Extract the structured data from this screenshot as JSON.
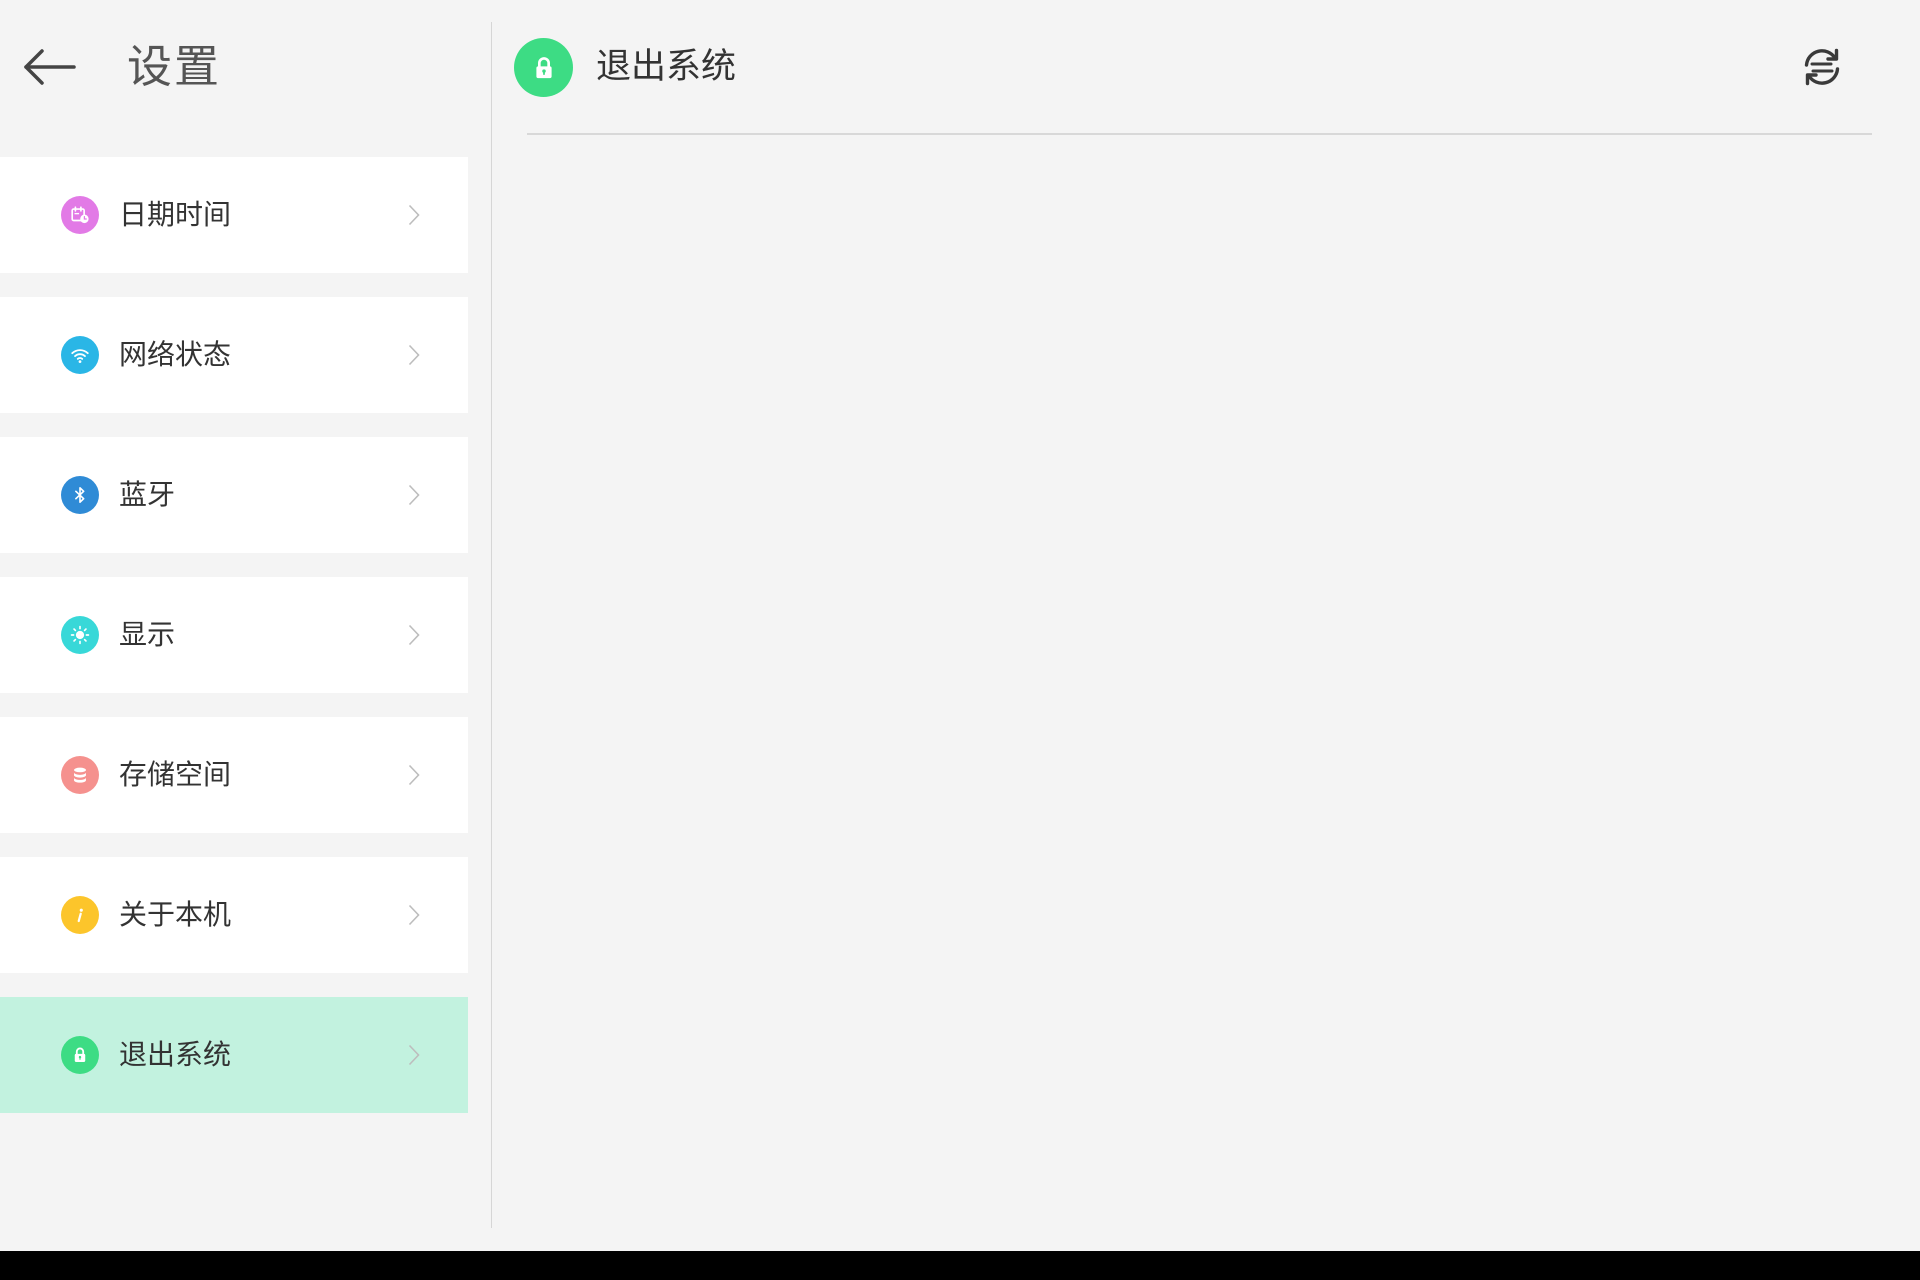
{
  "sidebar": {
    "title": "设置",
    "back_icon": "arrow-left-icon",
    "items": [
      {
        "label": "日期时间",
        "icon": "calendar-clock-icon",
        "color": "#e27ae6",
        "active": false
      },
      {
        "label": "网络状态",
        "icon": "wifi-icon",
        "color": "#2ab6e6",
        "active": false
      },
      {
        "label": "蓝牙",
        "icon": "bluetooth-icon",
        "color": "#2f8bd6",
        "active": false
      },
      {
        "label": "显示",
        "icon": "sun-icon",
        "color": "#38d8d8",
        "active": false
      },
      {
        "label": "存储空间",
        "icon": "database-icon",
        "color": "#f5918e",
        "active": false
      },
      {
        "label": "关于本机",
        "icon": "info-icon",
        "color": "#fcc52b",
        "active": false
      },
      {
        "label": "退出系统",
        "icon": "lock-icon",
        "color": "#3ddc84",
        "active": true
      }
    ]
  },
  "detail": {
    "title": "退出系统",
    "icon": "lock-icon",
    "icon_color": "#3ddc84",
    "refresh_icon": "refresh-icon"
  },
  "colors": {
    "background": "#f4f4f4",
    "card": "#ffffff",
    "active_card": "#c2f2df",
    "divider": "#d6d6d6",
    "bottom_bar": "#000000"
  }
}
